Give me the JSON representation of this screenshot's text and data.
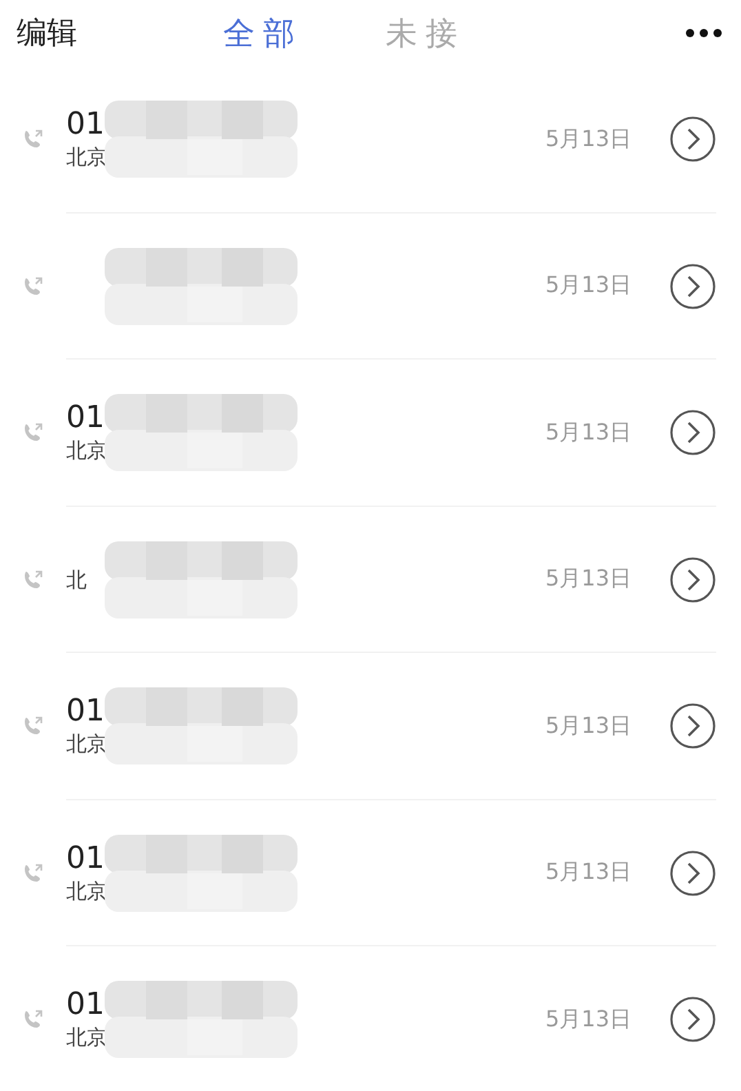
{
  "header": {
    "edit": "编辑",
    "tabs": [
      {
        "label": "全部",
        "selected": true
      },
      {
        "label": "未接",
        "selected": false
      }
    ]
  },
  "calls": [
    {
      "number": "01",
      "location": "北京",
      "date": "5月13日",
      "redacted": true
    },
    {
      "date": "5月13日",
      "redacted": true
    },
    {
      "number": "01",
      "location": "北京",
      "date": "5月13日",
      "redacted": true
    },
    {
      "location": "北",
      "date": "5月13日",
      "redacted": true
    },
    {
      "number": "01",
      "location": "北京",
      "date": "5月13日",
      "redacted": true
    },
    {
      "number": "01",
      "location": "北京",
      "date": "5月13日",
      "redacted": true
    },
    {
      "number": "01",
      "location": "北京",
      "date": "5月13日",
      "redacted": true
    }
  ]
}
